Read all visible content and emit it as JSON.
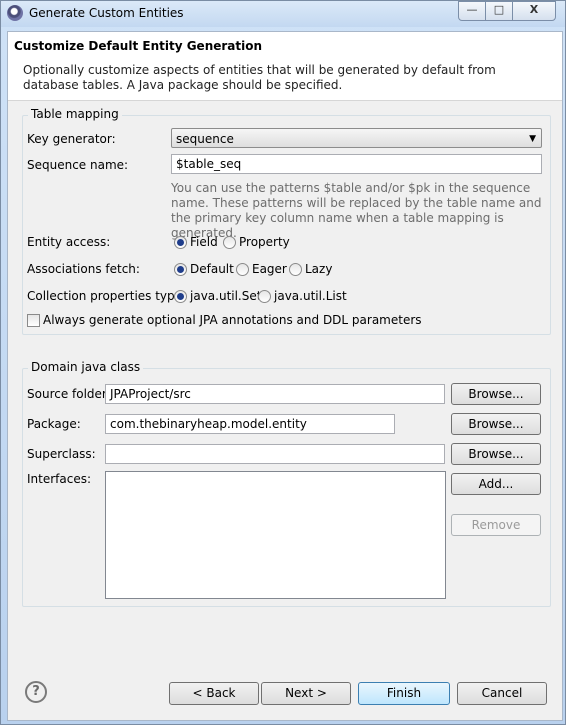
{
  "window": {
    "title": "Generate Custom Entities",
    "controls": {
      "minimize": "—",
      "maximize": "□",
      "close": "X"
    }
  },
  "header": {
    "title": "Customize Default Entity Generation",
    "description": "Optionally customize aspects of entities that will be generated by default from database tables. A Java package should be specified."
  },
  "table_mapping": {
    "legend": "Table mapping",
    "key_generator_label": "Key generator:",
    "key_generator_value": "sequence",
    "sequence_name_label": "Sequence name:",
    "sequence_name_value": "$table_seq",
    "hint": "You can use the patterns $table and/or $pk in the sequence name. These patterns will be replaced by the table name and the primary key column name when a table mapping is generated.",
    "entity_access_label": "Entity access:",
    "entity_access_options": [
      "Field",
      "Property"
    ],
    "entity_access_selected": "Field",
    "associations_fetch_label": "Associations fetch:",
    "associations_fetch_options": [
      "Default",
      "Eager",
      "Lazy"
    ],
    "associations_fetch_selected": "Default",
    "collection_type_label": "Collection properties type:",
    "collection_type_options": [
      "java.util.Set",
      "java.util.List"
    ],
    "collection_type_selected": "java.util.Set",
    "optional_annotations_label": "Always generate optional JPA annotations and DDL parameters",
    "optional_annotations_checked": false
  },
  "domain_class": {
    "legend": "Domain java class",
    "source_folder_label": "Source folder:",
    "source_folder_value": "JPAProject/src",
    "package_label": "Package:",
    "package_value": "com.thebinaryheap.model.entity",
    "superclass_label": "Superclass:",
    "superclass_value": "",
    "interfaces_label": "Interfaces:",
    "browse_label": "Browse...",
    "add_label": "Add...",
    "remove_label": "Remove"
  },
  "footer": {
    "help_icon": "?",
    "back_label": "< Back",
    "next_label": "Next >",
    "finish_label": "Finish",
    "cancel_label": "Cancel"
  }
}
